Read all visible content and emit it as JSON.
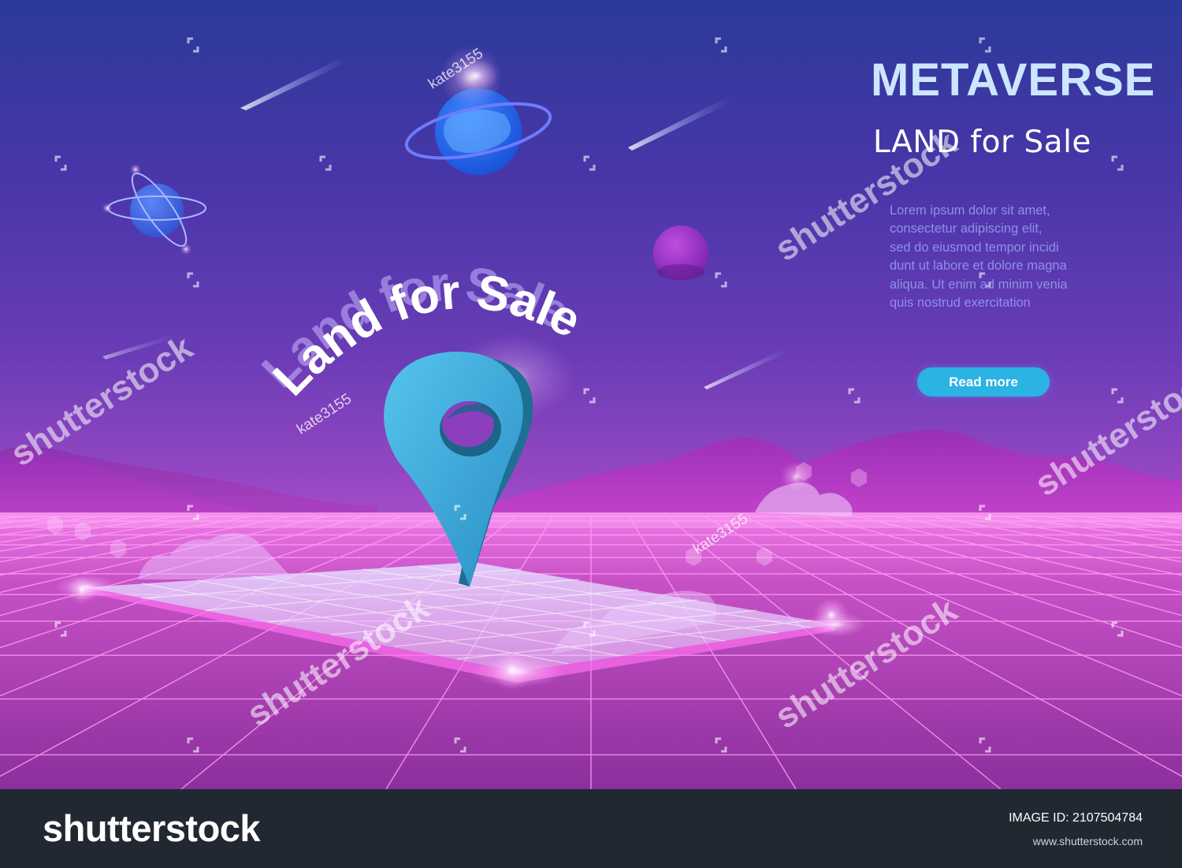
{
  "banner": {
    "headline": "METAVERSE",
    "subheadline": "LAND for Sale",
    "body_lines": [
      "Lorem ipsum dolor sit amet,",
      "consectetur adipiscing elit,",
      "sed do eiusmod tempor incidi",
      "dunt ut labore et dolore magna",
      "aliqua. Ut enim ad minim venia",
      "quis nostrud exercitation"
    ],
    "cta_label": "Read more",
    "accent_color": "#2ab3e3"
  },
  "illustration": {
    "curved_title": "Land for Sale",
    "pin_color": "#3aa7d6",
    "grid_color": "#ff9cf5"
  },
  "watermark": {
    "text": "shutterstock",
    "contributor": "kate3155"
  },
  "footer": {
    "logo_text": "shutterstock",
    "image_id": "IMAGE ID: 2107504784",
    "site_url": "www.shutterstock.com"
  }
}
